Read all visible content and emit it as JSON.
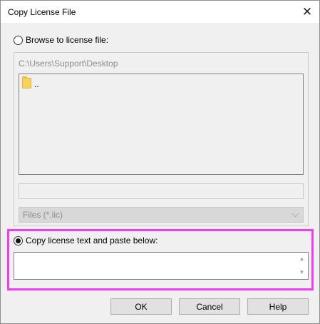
{
  "window": {
    "title": "Copy License File",
    "close_glyph": "✕"
  },
  "browse": {
    "label": "Browse to license file:",
    "path": "C:\\Users\\Support\\Desktop",
    "items": [
      {
        "label": "..",
        "icon": "folder-icon"
      }
    ],
    "filename_value": "",
    "filter_value": "Files (*.lic)"
  },
  "paste": {
    "label": "Copy license text and paste below:",
    "value": "",
    "highlight_color": "#f33cf2"
  },
  "buttons": {
    "ok": "OK",
    "cancel": "Cancel",
    "help": "Help"
  }
}
